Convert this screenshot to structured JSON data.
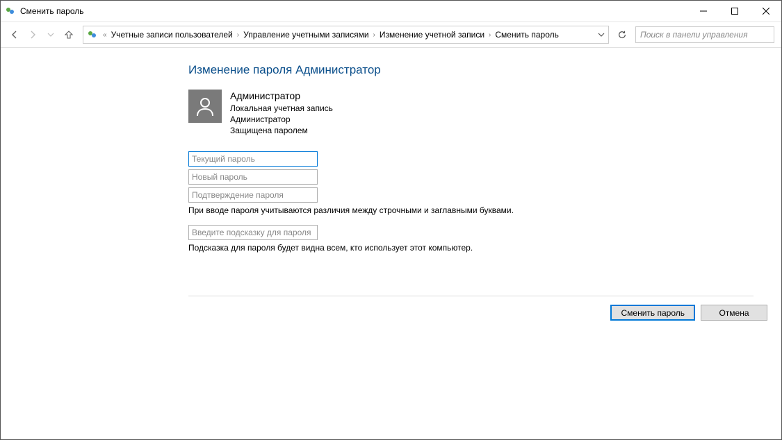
{
  "window": {
    "title": "Сменить пароль"
  },
  "breadcrumb": {
    "parts": [
      "Учетные записи пользователей",
      "Управление учетными записями",
      "Изменение учетной записи",
      "Сменить пароль"
    ]
  },
  "search": {
    "placeholder": "Поиск в панели управления"
  },
  "page": {
    "heading": "Изменение пароля Администратор",
    "account": {
      "name": "Администратор",
      "type": "Локальная учетная запись",
      "role": "Администратор",
      "protection": "Защищена паролем"
    },
    "inputs": {
      "current_placeholder": "Текущий пароль",
      "new_placeholder": "Новый пароль",
      "confirm_placeholder": "Подтверждение пароля",
      "hint_placeholder": "Введите подсказку для пароля"
    },
    "casing_note": "При вводе пароля учитываются различия между строчными и заглавными буквами.",
    "hint_note": "Подсказка для пароля будет видна всем, кто использует этот компьютер."
  },
  "buttons": {
    "change": "Сменить пароль",
    "cancel": "Отмена"
  }
}
